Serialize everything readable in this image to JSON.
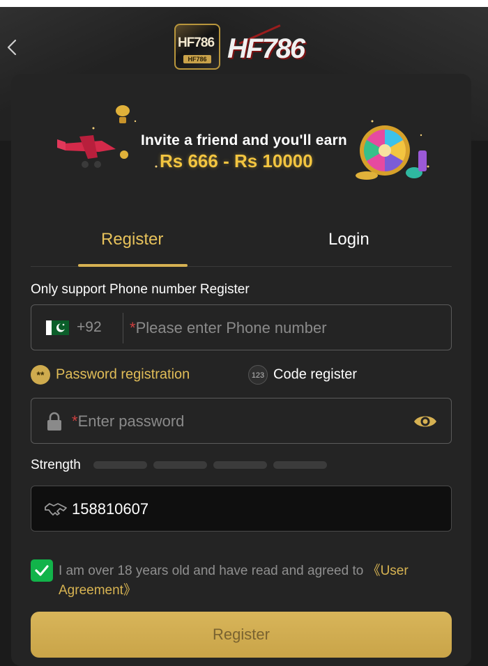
{
  "header": {
    "logo_badge_text": "HF786",
    "logo_badge_sub": "HF786",
    "logo_wordmark": "HF786"
  },
  "banner": {
    "line1": "Invite a friend and you'll earn",
    "line2": "Rs 666 - Rs 10000"
  },
  "tabs": [
    {
      "label": "Register",
      "active": true
    },
    {
      "label": "Login",
      "active": false
    }
  ],
  "form": {
    "support_label": "Only support Phone number Register",
    "phone": {
      "country_code": "+92",
      "required_mark": "*",
      "placeholder": "Please enter Phone number"
    },
    "options": {
      "password_icon_text": "**",
      "password_label": "Password registration",
      "code_icon_text": "123",
      "code_label": "Code register"
    },
    "password": {
      "required_mark": "*",
      "placeholder": "Enter password"
    },
    "strength_label": "Strength",
    "strength_segments": 4,
    "strength_filled": 0,
    "invite_code": "158810607",
    "agreement": {
      "checked": true,
      "text": "I am over 18 years old and have read and agreed to ",
      "link": "《User Agreement》"
    },
    "submit_label": "Register"
  },
  "colors": {
    "accent_gold": "#d6b152",
    "background": "#1b1b1b",
    "card": "#242424",
    "checkbox_green": "#12b34a",
    "required_red": "#cf3f3f"
  },
  "icons": [
    "back-arrow-icon",
    "pakistan-flag-icon",
    "lock-icon",
    "eye-icon",
    "handshake-icon",
    "check-icon"
  ]
}
